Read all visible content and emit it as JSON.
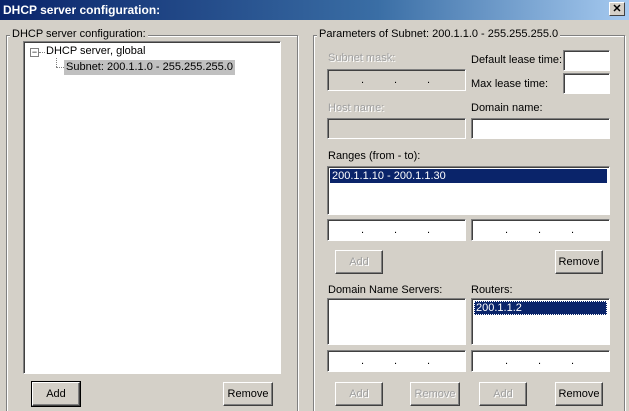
{
  "window": {
    "title": "DHCP server configuration:",
    "close_glyph": "✕"
  },
  "left_group": {
    "label": "DHCP server configuration:",
    "tree": {
      "root_toggle": "−",
      "root_label": "DHCP server, global",
      "child_label": "Subnet: 200.1.1.0 - 255.255.255.0"
    },
    "add_label": "Add",
    "remove_label": "Remove"
  },
  "right_group": {
    "label": "Parameters of Subnet: 200.1.1.0 - 255.255.255.0",
    "subnet_mask_label": "Subnet mask:",
    "default_lease_label": "Default lease time:",
    "default_lease_value": "",
    "max_lease_label": "Max lease time:",
    "max_lease_value": "",
    "host_name_label": "Host name:",
    "host_name_value": "",
    "domain_name_label": "Domain name:",
    "domain_name_value": "",
    "ranges_label": "Ranges (from - to):",
    "ranges": [
      "200.1.1.10 - 200.1.1.30"
    ],
    "ranges_add_label": "Add",
    "ranges_remove_label": "Remove",
    "dns_label": "Domain Name Servers:",
    "dns_servers": [],
    "routers_label": "Routers:",
    "routers": [
      "200.1.1.2"
    ],
    "dns_add_label": "Add",
    "dns_remove_label": "Remove",
    "routers_add_label": "Add",
    "routers_remove_label": "Remove",
    "ip_dot": "."
  }
}
